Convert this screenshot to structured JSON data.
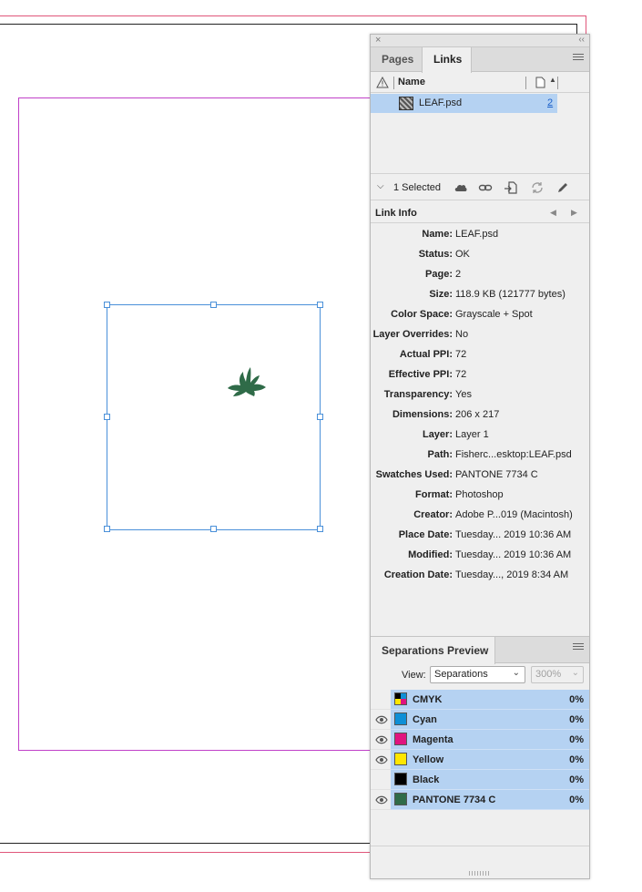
{
  "panel": {
    "tabs": [
      {
        "label": "Pages"
      },
      {
        "label": "Links"
      }
    ]
  },
  "links": {
    "columns": {
      "name": "Name"
    },
    "items": [
      {
        "name": "LEAF.psd",
        "page": "2"
      }
    ],
    "status": "1 Selected"
  },
  "link_info": {
    "title": "Link Info",
    "rows": [
      {
        "label": "Name:",
        "value": "LEAF.psd"
      },
      {
        "label": "Status:",
        "value": "OK"
      },
      {
        "label": "Page:",
        "value": "2"
      },
      {
        "label": "Size:",
        "value": "118.9 KB (121777 bytes)"
      },
      {
        "label": "Color Space:",
        "value": "Grayscale + Spot"
      },
      {
        "label": "Layer Overrides:",
        "value": "No"
      },
      {
        "label": "Actual PPI:",
        "value": "72"
      },
      {
        "label": "Effective PPI:",
        "value": "72"
      },
      {
        "label": "Transparency:",
        "value": "Yes"
      },
      {
        "label": "Dimensions:",
        "value": "206 x 217"
      },
      {
        "label": "Layer:",
        "value": "Layer 1"
      },
      {
        "label": "Path:",
        "value": "Fisherc...esktop:LEAF.psd"
      },
      {
        "label": "Swatches Used:",
        "value": "PANTONE 7734 C"
      },
      {
        "label": "Format:",
        "value": "Photoshop"
      },
      {
        "label": "Creator:",
        "value": "Adobe P...019 (Macintosh)"
      },
      {
        "label": "Place Date:",
        "value": "Tuesday... 2019 10:36 AM"
      },
      {
        "label": "Modified:",
        "value": "Tuesday... 2019 10:36 AM"
      },
      {
        "label": "Creation Date:",
        "value": "Tuesday..., 2019 8:34 AM"
      }
    ]
  },
  "separations": {
    "title": "Separations Preview",
    "view_label": "View:",
    "view_value": "Separations",
    "zoom_value": "300%",
    "items": [
      {
        "name": "CMYK",
        "percent": "0%",
        "color": "cmyk",
        "visible": false
      },
      {
        "name": "Cyan",
        "percent": "0%",
        "color": "#0f8fd6",
        "visible": true
      },
      {
        "name": "Magenta",
        "percent": "0%",
        "color": "#e0147f",
        "visible": true
      },
      {
        "name": "Yellow",
        "percent": "0%",
        "color": "#ffe600",
        "visible": true
      },
      {
        "name": "Black",
        "percent": "0%",
        "color": "#000000",
        "visible": false
      },
      {
        "name": "PANTONE 7734 C",
        "percent": "0%",
        "color": "#2f6b48",
        "visible": true
      }
    ]
  },
  "colors": {
    "selection": "#4a90d9",
    "row_highlight": "#b5d2f2",
    "leaf": "#2f6b48",
    "bleed_guide": "#e0567a",
    "margin_guide": "#c040c8"
  }
}
